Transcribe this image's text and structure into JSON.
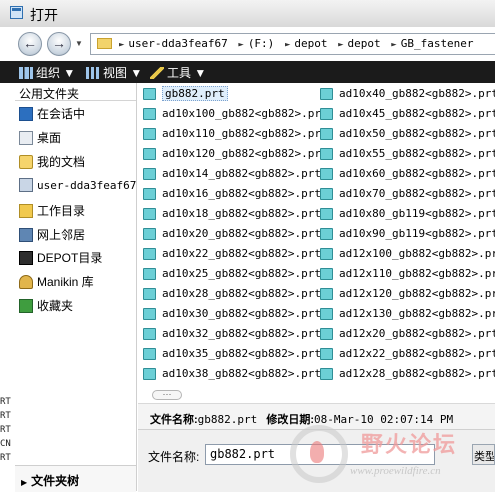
{
  "window": {
    "title": "打开"
  },
  "address": {
    "crumbs": [
      "user-dda3feaf67",
      "(F:)",
      "depot",
      "depot",
      "GB_fastener"
    ]
  },
  "toolbar": {
    "organize": "组织",
    "views": "视图",
    "tools": "工具"
  },
  "sidebar": {
    "header": "公用文件夹",
    "items": [
      {
        "label": "在会话中",
        "icon": "session-desktop-icon"
      },
      {
        "label": "桌面",
        "icon": "desktop-icon"
      },
      {
        "label": "我的文档",
        "icon": "my-documents-icon"
      },
      {
        "label": "user-dda3feaf67",
        "icon": "computer-icon"
      },
      {
        "label": "工作目录",
        "icon": "working-directory-icon"
      },
      {
        "label": "网上邻居",
        "icon": "network-icon"
      },
      {
        "label": "DEPOT目录",
        "icon": "depot-icon"
      },
      {
        "label": "Manikin 库",
        "icon": "manikin-icon"
      },
      {
        "label": "收藏夹",
        "icon": "favorites-icon"
      }
    ],
    "folder_tree": "文件夹树"
  },
  "files": {
    "column1": [
      "gb882.prt",
      "ad10x100_gb882<gb882>.prt",
      "ad10x110_gb882<gb882>.prt",
      "ad10x120_gb882<gb882>.prt",
      "ad10x14_gb882<gb882>.prt",
      "ad10x16_gb882<gb882>.prt",
      "ad10x18_gb882<gb882>.prt",
      "ad10x20_gb882<gb882>.prt",
      "ad10x22_gb882<gb882>.prt",
      "ad10x25_gb882<gb882>.prt",
      "ad10x28_gb882<gb882>.prt",
      "ad10x30_gb882<gb882>.prt",
      "ad10x32_gb882<gb882>.prt",
      "ad10x35_gb882<gb882>.prt",
      "ad10x38_gb882<gb882>.prt"
    ],
    "column2": [
      "ad10x40_gb882<gb882>.prt",
      "ad10x45_gb882<gb882>.prt",
      "ad10x50_gb882<gb882>.prt",
      "ad10x55_gb882<gb882>.prt",
      "ad10x60_gb882<gb882>.prt",
      "ad10x70_gb882<gb882>.prt",
      "ad10x80_gb119<gb882>.prt",
      "ad10x90_gb119<gb882>.prt",
      "ad12x100_gb882<gb882>.prt",
      "ad12x110_gb882<gb882>.prt",
      "ad12x120_gb882<gb882>.prt",
      "ad12x130_gb882<gb882>.prt",
      "ad12x20_gb882<gb882>.prt",
      "ad12x22_gb882<gb882>.prt",
      "ad12x28_gb882<gb882>.prt"
    ]
  },
  "details": {
    "name_label": "文件名称:",
    "name_value": "gb882.prt",
    "date_label": "修改日期:",
    "date_value": "08-Mar-10 02:07:14 PM"
  },
  "bottom": {
    "filename_label": "文件名称:",
    "filename_value": "gb882.prt",
    "type_label": "类型"
  },
  "edge_text": [
    "RT",
    "RT",
    "RT",
    "CN",
    "RT"
  ],
  "watermark": {
    "text_cn": "野火论坛",
    "url": "www.proewildfire.cn"
  }
}
